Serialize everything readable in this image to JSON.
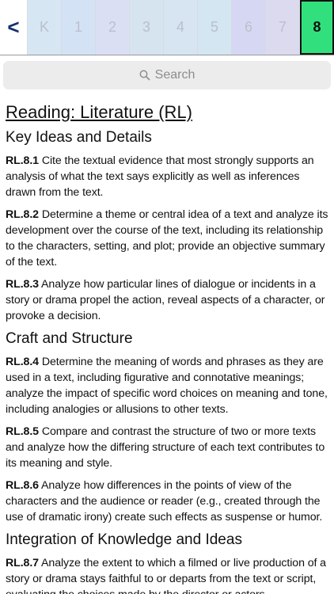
{
  "grades": {
    "back_label": "<",
    "tabs": [
      {
        "label": "K",
        "bg": "#d7e6f3"
      },
      {
        "label": "1",
        "bg": "#d4e2f6"
      },
      {
        "label": "2",
        "bg": "#dbdff4"
      },
      {
        "label": "3",
        "bg": "#d6e4f0"
      },
      {
        "label": "4",
        "bg": "#d6e5f1"
      },
      {
        "label": "5",
        "bg": "#d3e6f1"
      },
      {
        "label": "6",
        "bg": "#d6d8f3"
      },
      {
        "label": "7",
        "bg": "#dcdaef"
      },
      {
        "label": "8",
        "bg": "#31e07c"
      }
    ],
    "selected": "8"
  },
  "search": {
    "placeholder": "Search"
  },
  "page_title": "Reading: Literature (RL)",
  "sections": [
    {
      "title": "Key Ideas and Details",
      "standards": [
        {
          "code": "RL.8.1",
          "text": " Cite the textual evidence that most strongly supports an analysis of what the text says explicitly as well as inferences drawn from the text."
        },
        {
          "code": "RL.8.2",
          "text": " Determine a theme or central idea of a text and analyze its development over the course of the text, including its relationship to the characters, setting, and plot; provide an objective summary of the text."
        },
        {
          "code": "RL.8.3",
          "text": " Analyze how particular lines of dialogue or incidents in a story or drama propel the action, reveal aspects of a character, or provoke a decision."
        }
      ]
    },
    {
      "title": "Craft and Structure",
      "standards": [
        {
          "code": "RL.8.4",
          "text": " Determine the meaning of words and phrases as they are used in a text, including figurative and connotative meanings; analyze the impact of specific word choices on meaning and tone, including analogies or allusions to other texts."
        },
        {
          "code": "RL.8.5",
          "text": " Compare and contrast the structure of two or more texts and analyze how the differing structure of each text contributes to its meaning and style."
        },
        {
          "code": "RL.8.6",
          "text": " Analyze how differences in the points of view of the characters and the audience or reader (e.g., created through the use of dramatic irony) create such effects as suspense or humor."
        }
      ]
    },
    {
      "title": "Integration of Knowledge and Ideas",
      "standards": [
        {
          "code": "RL.8.7",
          "text": " Analyze the extent to which a filmed or live production of a story or drama stays faithful to or departs from the text or script, evaluating the choices made by the director or actors."
        }
      ]
    }
  ]
}
